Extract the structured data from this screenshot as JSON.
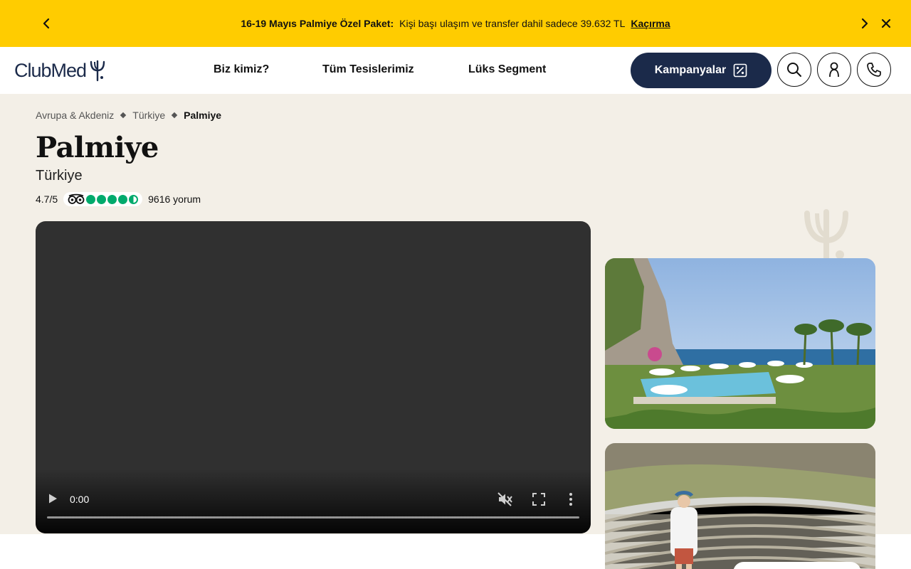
{
  "promo": {
    "bold_text": "16-19 Mayıs Palmiye Özel Paket:",
    "text": "Kişi başı ulaşım ve transfer dahil sadece 39.632 TL",
    "link": "Kaçırma"
  },
  "header": {
    "logo_text": "ClubMed",
    "nav": [
      "Biz kimiz?",
      "Tüm Tesislerimiz",
      "Lüks Segment"
    ],
    "campaign_label": "Kampanyalar"
  },
  "breadcrumb": [
    "Avrupa & Akdeniz",
    "Türkiye",
    "Palmiye"
  ],
  "page": {
    "title": "Palmiye",
    "subtitle": "Türkiye",
    "rating": "4.7/5",
    "rating_bubbles": 4.5,
    "reviews": "9616 yorum"
  },
  "video": {
    "time": "0:00",
    "progress": 0
  },
  "colors": {
    "promo_bg": "#ffcc00",
    "brand_navy": "#1b2a4a",
    "beige_bg": "#f3efe7",
    "tripadvisor_green": "#00aa6c"
  },
  "icons": [
    "chevron-left-icon",
    "chevron-right-icon",
    "close-icon",
    "percent-icon",
    "search-icon",
    "user-icon",
    "phone-icon",
    "trident-icon",
    "tripadvisor-owl-icon",
    "play-icon",
    "mute-icon",
    "fullscreen-icon",
    "more-vertical-icon"
  ]
}
